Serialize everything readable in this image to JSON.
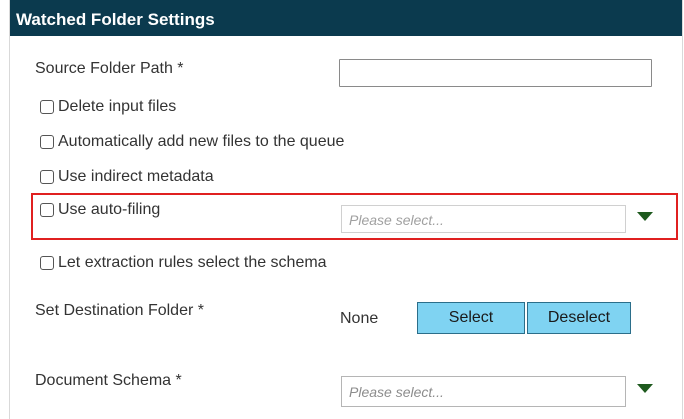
{
  "header": {
    "title": "Watched Folder Settings"
  },
  "fields": {
    "source_folder_label": "Source Folder Path *",
    "source_folder_value": "",
    "delete_input_label": "Delete input files",
    "auto_add_label": "Automatically add new files to the queue",
    "indirect_metadata_label": "Use indirect metadata",
    "auto_filing_label": "Use auto-filing",
    "auto_filing_select": "Please select...",
    "extraction_rules_label": "Let extraction rules select the schema",
    "destination_label": "Set Destination Folder *",
    "destination_value": "None",
    "select_button": "Select",
    "deselect_button": "Deselect",
    "schema_label": "Document Schema *",
    "schema_select": "Please select..."
  },
  "colors": {
    "header_bg": "#0b3a4e",
    "button_bg": "#7fd3f2",
    "highlight_border": "#e02020",
    "caret": "#1e5a1e"
  }
}
